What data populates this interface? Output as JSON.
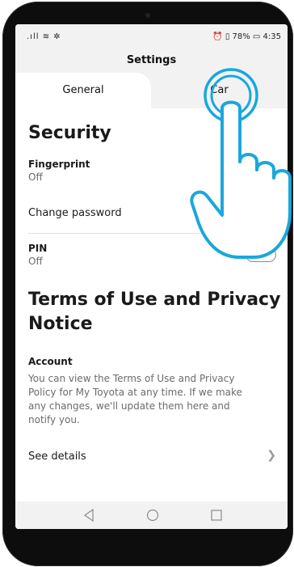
{
  "status_bar": {
    "left_icons": ".ıll ≋ ✲",
    "right_text": "⏰ ▯ 78% ▭ 4:35"
  },
  "header": {
    "title": "Settings"
  },
  "tabs": [
    {
      "label": "General",
      "selected": true
    },
    {
      "label": "Car",
      "selected": false
    }
  ],
  "security": {
    "title": "Security",
    "fingerprint": {
      "label": "Fingerprint",
      "value": "Off"
    },
    "change_password": {
      "label": "Change password"
    },
    "pin": {
      "label": "PIN",
      "value": "Off",
      "toggle_on": false
    }
  },
  "terms": {
    "title_line1": "Terms of Use and Privacy",
    "title_line2": "Notice",
    "account_label": "Account",
    "desc_line1": "You can view the Terms of Use and Privacy",
    "desc_line2": "Policy for My Toyota at any time. If we make",
    "desc_line3": "any changes, we'll update them here and",
    "desc_line4": "notify you.",
    "see_details": "See details"
  },
  "nav": {
    "back_icon": "triangle-back",
    "home_icon": "circle-home",
    "recents_icon": "square-recents"
  },
  "colors": {
    "accent": "#1aa7dc",
    "header_bg": "#f2f2f2",
    "text_secondary": "#6b6b6b"
  }
}
